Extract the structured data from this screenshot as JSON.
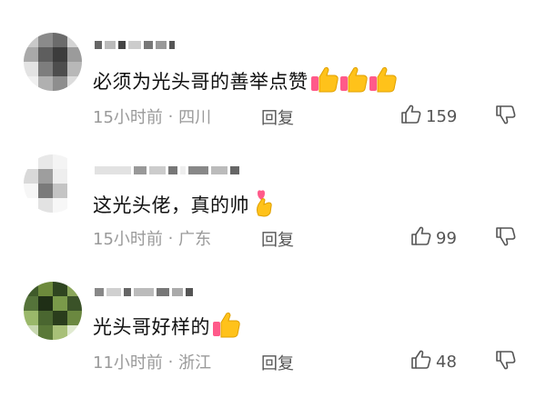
{
  "colors": {
    "meta_gray": "#9a9a9a",
    "icon_gray": "#555555",
    "thumb_yellow": "#ffc21a",
    "heart_pink": "#ff5a8a"
  },
  "comments": [
    {
      "text": "必须为光头哥的善举点赞",
      "time": "15小时前",
      "location": "四川",
      "reply_label": "回复",
      "likes": "159",
      "emoji": [
        "thumbs-up-icon",
        "thumbs-up-icon",
        "thumbs-up-icon"
      ]
    },
    {
      "text": "这光头佬，真的帅",
      "time": "15小时前",
      "location": "广东",
      "reply_label": "回复",
      "likes": "99",
      "emoji": [
        "finger-heart-icon"
      ]
    },
    {
      "text": "光头哥好样的",
      "time": "11小时前",
      "location": "浙江",
      "reply_label": "回复",
      "likes": "48",
      "emoji": [
        "thumbs-up-icon"
      ]
    }
  ],
  "separator": " · "
}
